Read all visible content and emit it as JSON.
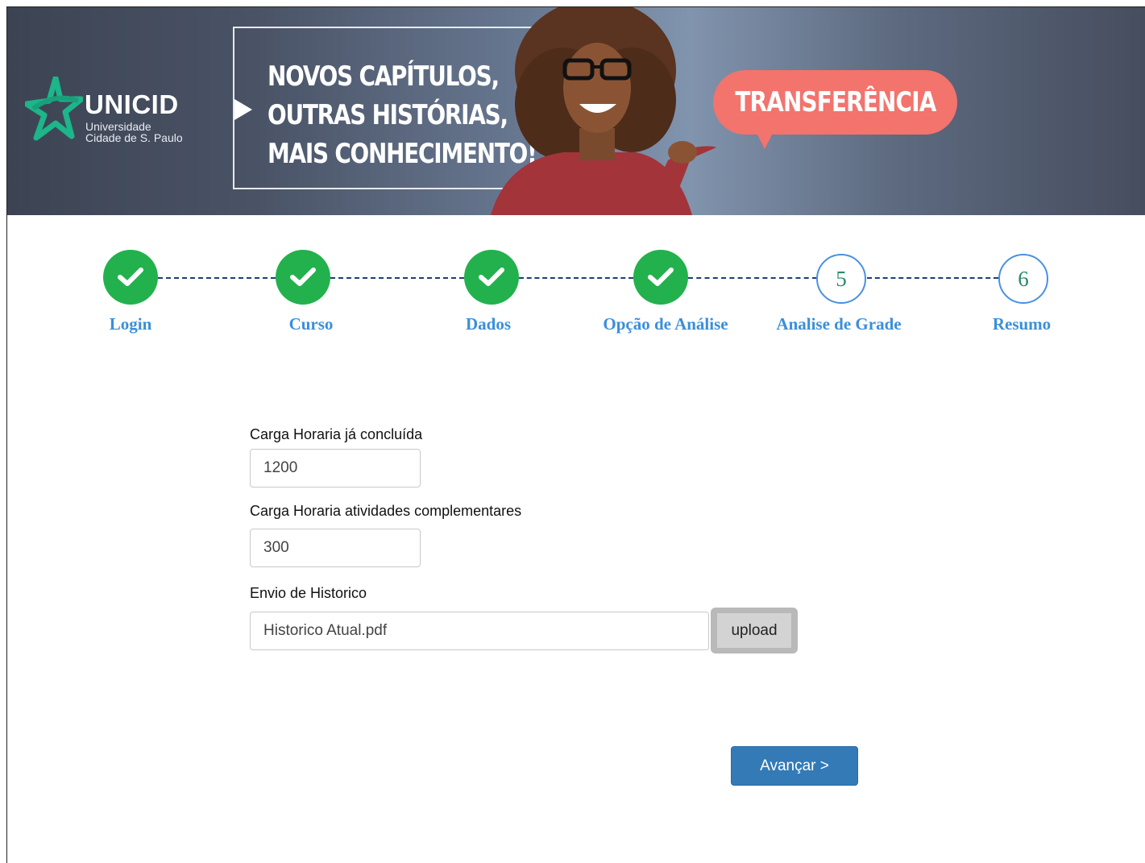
{
  "banner": {
    "brand": "UNICID",
    "brand_sub_1": "Universidade",
    "brand_sub_2": "Cidade de S. Paulo",
    "headline_1": "NOVOS CAPÍTULOS,",
    "headline_2": "OUTRAS HISTÓRIAS,",
    "headline_3": "MAIS CONHECIMENTO!",
    "bubble": "TRANSFERÊNCIA"
  },
  "colors": {
    "step_done": "#23b14d",
    "step_label": "#3b8fd9",
    "primary_button": "#337ab7",
    "bubble": "#f3736d"
  },
  "stepper": {
    "steps": [
      {
        "label": "Login",
        "state": "done",
        "icon": "check-icon"
      },
      {
        "label": "Curso",
        "state": "done",
        "icon": "check-icon"
      },
      {
        "label": "Dados",
        "state": "done",
        "icon": "check-icon"
      },
      {
        "label": "Opção de Análise",
        "state": "done",
        "icon": "check-icon"
      },
      {
        "label": "Analise de Grade",
        "state": "current",
        "number": "5"
      },
      {
        "label": "Resumo",
        "state": "pending",
        "number": "6"
      }
    ]
  },
  "form": {
    "carga_concluida_label": "Carga Horaria já concluída",
    "carga_concluida_value": "1200",
    "carga_complementar_label": "Carga Horaria atividades complementares",
    "carga_complementar_value": "300",
    "historico_label": "Envio de Historico",
    "historico_value": "Historico Atual.pdf",
    "upload_label": "upload",
    "advance_label": "Avançar >"
  }
}
